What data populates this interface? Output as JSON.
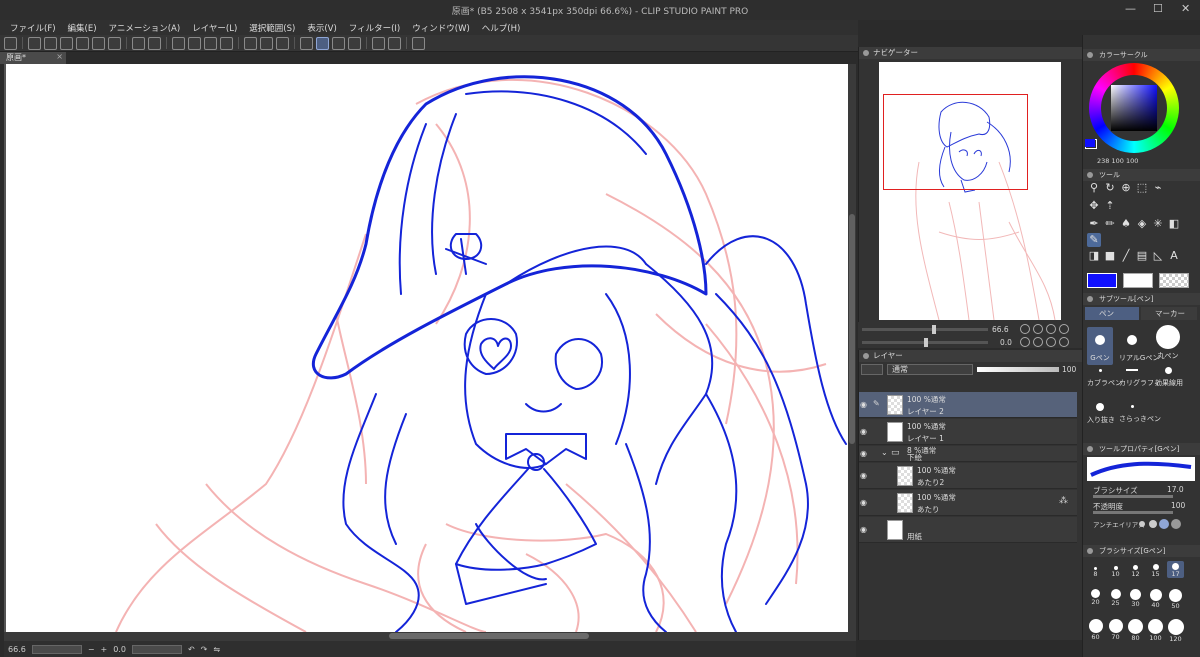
{
  "window": {
    "title": "原画* (B5 2508 x 3541px 350dpi 66.6%)  - CLIP STUDIO PAINT PRO",
    "controls": [
      "—",
      "☐",
      "✕"
    ]
  },
  "menu": [
    "ファイル(F)",
    "編集(E)",
    "アニメーション(A)",
    "レイヤー(L)",
    "選択範囲(S)",
    "表示(V)",
    "フィルター(I)",
    "ウィンドウ(W)",
    "ヘルプ(H)"
  ],
  "document_tab": {
    "label": "原画*",
    "close": "×"
  },
  "status": {
    "zoom": "66.6",
    "angle": "0.0"
  },
  "navigator": {
    "tab_label": "ナビゲーター",
    "zoom_value": "66.6",
    "angle_value": "0.0",
    "view_rect_color": "#e02020"
  },
  "layers": {
    "tab_label": "レイヤー",
    "blend_mode": "通常",
    "opacity": "100",
    "items": [
      {
        "line1": "100 %通常",
        "line2": "レイヤー 2",
        "selected": true,
        "thumb": "checker",
        "indent": 0
      },
      {
        "line1": "100 %通常",
        "line2": "レイヤー 1",
        "selected": false,
        "thumb": "white",
        "indent": 0
      },
      {
        "line1": "8 %通常",
        "line2": "下絵",
        "selected": false,
        "thumb": "folder",
        "indent": 0
      },
      {
        "line1": "100 %通常",
        "line2": "あたり2",
        "selected": false,
        "thumb": "checker",
        "indent": 1
      },
      {
        "line1": "100 %通常",
        "line2": "あたり",
        "selected": false,
        "thumb": "checker",
        "indent": 1
      },
      {
        "line1": "",
        "line2": "用紙",
        "selected": false,
        "thumb": "white",
        "indent": 0
      }
    ]
  },
  "color_wheel": {
    "label": "カラーサークル",
    "main_color": "#1010ff",
    "sub_color": "#ffffff",
    "values": [
      "238",
      "100",
      "100"
    ]
  },
  "tool_panel": {
    "label": "ツール"
  },
  "sub_tool": {
    "label": "サブツール[ペン]",
    "tabs": [
      "ペン",
      "マーカー"
    ],
    "brushes": [
      "Gペン",
      "リアルGペン",
      "丸ペン",
      "カブラペン",
      "カリグラフィ",
      "効果線用",
      "入り抜き",
      "さらっきペン"
    ]
  },
  "tool_property": {
    "label": "ツールプロパティ[Gペン]",
    "brush_size_label": "ブラシサイズ",
    "brush_size": "17.0",
    "opacity_label": "不透明度",
    "opacity": "100",
    "antialias_label": "アンチエイリアス"
  },
  "brush_size_panel": {
    "label": "ブラシサイズ[Gペン]",
    "sizes": [
      "8",
      "10",
      "12",
      "15",
      "17",
      "20",
      "25",
      "30",
      "40",
      "50",
      "60",
      "70",
      "80",
      "100",
      "120"
    ]
  },
  "colors": {
    "lineart": "#1424d8",
    "sketch": "#f4b3b3",
    "selected_layer": "#56627a"
  }
}
